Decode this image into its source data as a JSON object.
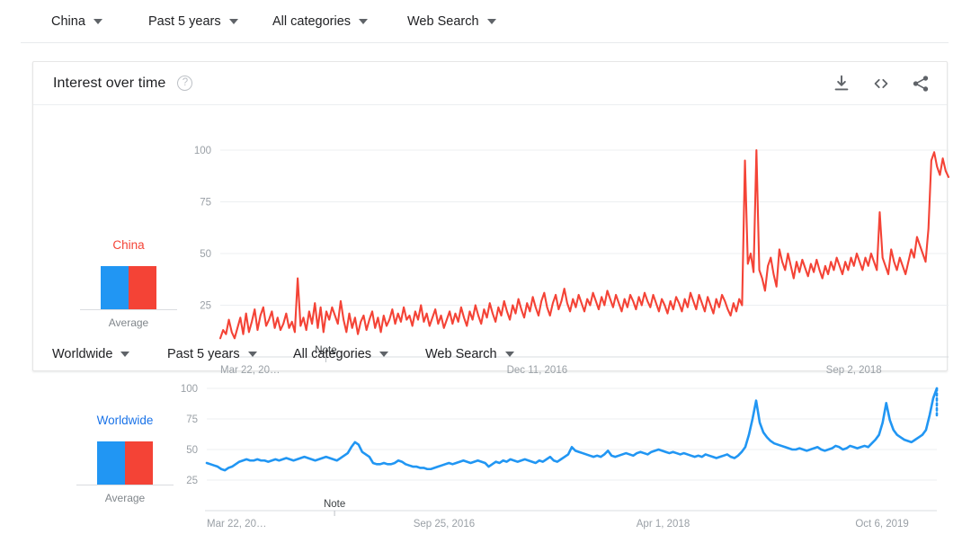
{
  "page": {
    "background": "#ffffff",
    "accent_blue": "#1a73e8",
    "line_blue": "#2196f3",
    "line_red": "#f44336",
    "legend_blue": "#2196f3",
    "legend_red": "#f44336"
  },
  "top_filters": [
    {
      "label": "China",
      "icon": "chevron-down-icon"
    },
    {
      "label": "Past 5 years",
      "icon": "chevron-down-icon"
    },
    {
      "label": "All categories",
      "icon": "chevron-down-icon"
    },
    {
      "label": "Web Search",
      "icon": "chevron-down-icon"
    }
  ],
  "second_filters": [
    {
      "label": "Worldwide",
      "icon": "chevron-down-icon"
    },
    {
      "label": "Past 5 years",
      "icon": "chevron-down-icon"
    },
    {
      "label": "All categories",
      "icon": "chevron-down-icon"
    },
    {
      "label": "Web Search",
      "icon": "chevron-down-icon"
    }
  ],
  "card1": {
    "title": "Interest over time",
    "help_icon": "help-circle-icon",
    "actions": [
      {
        "name": "download-icon",
        "title": "Download"
      },
      {
        "name": "embed-code-icon",
        "title": "Embed"
      },
      {
        "name": "share-icon",
        "title": "Share"
      }
    ],
    "legend": {
      "label": "China",
      "label_color": "#f44336",
      "average_caption": "Average"
    },
    "note_label": "Note"
  },
  "card2": {
    "legend": {
      "label": "Worldwide",
      "label_color": "#1a73e8",
      "average_caption": "Average"
    },
    "note_label": "Note"
  },
  "chart_data": [
    {
      "id": "china-interest-over-time",
      "type": "line",
      "title": "Interest over time",
      "series_name": "China",
      "color": "#f44336",
      "xlabel": "",
      "ylabel": "",
      "ylim": [
        0,
        100
      ],
      "yticks": [
        100,
        75,
        50,
        25
      ],
      "grid": true,
      "legend_position": "left",
      "xtick_labels": [
        "Mar 22, 20…",
        "Dec 11, 2016",
        "Sep 2, 2018"
      ],
      "xtick_positions": [
        0,
        0.435,
        0.87
      ],
      "annotations": [
        {
          "text": "Note",
          "x": 0.145
        }
      ],
      "values": [
        9,
        13,
        11,
        18,
        12,
        9,
        14,
        19,
        11,
        21,
        12,
        17,
        23,
        13,
        20,
        24,
        15,
        18,
        22,
        14,
        19,
        13,
        16,
        21,
        14,
        17,
        12,
        38,
        15,
        19,
        13,
        22,
        16,
        26,
        14,
        24,
        12,
        22,
        18,
        24,
        20,
        16,
        27,
        18,
        12,
        21,
        14,
        19,
        11,
        17,
        20,
        13,
        18,
        22,
        14,
        19,
        12,
        20,
        15,
        18,
        23,
        16,
        21,
        17,
        24,
        18,
        20,
        15,
        22,
        18,
        25,
        17,
        21,
        15,
        19,
        23,
        16,
        20,
        14,
        18,
        22,
        16,
        21,
        17,
        24,
        19,
        15,
        22,
        18,
        25,
        20,
        16,
        23,
        19,
        26,
        21,
        17,
        24,
        20,
        27,
        22,
        18,
        25,
        21,
        28,
        23,
        19,
        26,
        22,
        29,
        24,
        20,
        27,
        31,
        24,
        20,
        26,
        30,
        23,
        27,
        33,
        26,
        22,
        28,
        24,
        30,
        26,
        22,
        28,
        25,
        31,
        27,
        23,
        29,
        25,
        32,
        28,
        24,
        30,
        26,
        22,
        28,
        24,
        30,
        27,
        23,
        29,
        25,
        31,
        27,
        24,
        30,
        26,
        22,
        28,
        25,
        21,
        27,
        23,
        29,
        26,
        22,
        28,
        24,
        31,
        27,
        23,
        30,
        26,
        22,
        29,
        25,
        21,
        28,
        24,
        30,
        27,
        23,
        20,
        26,
        22,
        28,
        25,
        95,
        45,
        50,
        41,
        100,
        42,
        38,
        32,
        44,
        48,
        40,
        34,
        52,
        46,
        42,
        50,
        44,
        38,
        46,
        41,
        47,
        43,
        39,
        45,
        41,
        47,
        42,
        38,
        44,
        40,
        46,
        42,
        48,
        44,
        40,
        46,
        42,
        48,
        44,
        50,
        46,
        42,
        48,
        44,
        50,
        46,
        42,
        70,
        48,
        44,
        40,
        52,
        46,
        42,
        48,
        44,
        40,
        46,
        52,
        48,
        58,
        54,
        50,
        46,
        62,
        95,
        99,
        92,
        88,
        96,
        90,
        87
      ]
    },
    {
      "id": "worldwide-interest-over-time",
      "type": "line",
      "title": "",
      "series_name": "Worldwide",
      "color": "#2196f3",
      "xlabel": "",
      "ylabel": "",
      "ylim": [
        0,
        100
      ],
      "yticks": [
        100,
        75,
        50,
        25
      ],
      "grid": true,
      "legend_position": "left",
      "xtick_labels": [
        "Mar 22, 20…",
        "Sep 25, 2016",
        "Apr 1, 2018",
        "Oct 6, 2019"
      ],
      "xtick_positions": [
        0,
        0.325,
        0.625,
        0.925
      ],
      "annotations": [
        {
          "text": "Note",
          "x": 0.175
        }
      ],
      "partial_data_dotted": true,
      "values": [
        39,
        38,
        37,
        36,
        34,
        33,
        35,
        36,
        38,
        40,
        41,
        42,
        41,
        41,
        42,
        41,
        41,
        40,
        41,
        42,
        41,
        42,
        43,
        42,
        41,
        42,
        43,
        44,
        43,
        42,
        41,
        42,
        43,
        44,
        43,
        42,
        41,
        43,
        45,
        47,
        52,
        56,
        54,
        48,
        46,
        44,
        39,
        38,
        38,
        39,
        38,
        38,
        39,
        41,
        40,
        38,
        37,
        36,
        36,
        35,
        35,
        34,
        34,
        35,
        36,
        37,
        38,
        39,
        38,
        39,
        40,
        41,
        40,
        39,
        40,
        41,
        40,
        39,
        36,
        38,
        40,
        39,
        41,
        40,
        42,
        41,
        40,
        41,
        42,
        41,
        40,
        39,
        41,
        40,
        42,
        44,
        41,
        40,
        42,
        44,
        46,
        52,
        49,
        48,
        47,
        46,
        45,
        44,
        45,
        44,
        46,
        49,
        45,
        44,
        45,
        46,
        47,
        46,
        45,
        47,
        48,
        47,
        46,
        48,
        49,
        50,
        49,
        48,
        47,
        48,
        47,
        46,
        47,
        46,
        45,
        44,
        45,
        44,
        46,
        45,
        44,
        43,
        44,
        45,
        46,
        44,
        43,
        45,
        48,
        52,
        62,
        75,
        90,
        72,
        64,
        60,
        57,
        55,
        54,
        53,
        52,
        51,
        50,
        50,
        51,
        50,
        49,
        50,
        51,
        52,
        50,
        49,
        50,
        51,
        53,
        52,
        50,
        51,
        53,
        52,
        51,
        52,
        53,
        52,
        55,
        58,
        62,
        72,
        88,
        74,
        66,
        62,
        60,
        58,
        57,
        56,
        58,
        60,
        62,
        66,
        78,
        92,
        100
      ]
    }
  ]
}
